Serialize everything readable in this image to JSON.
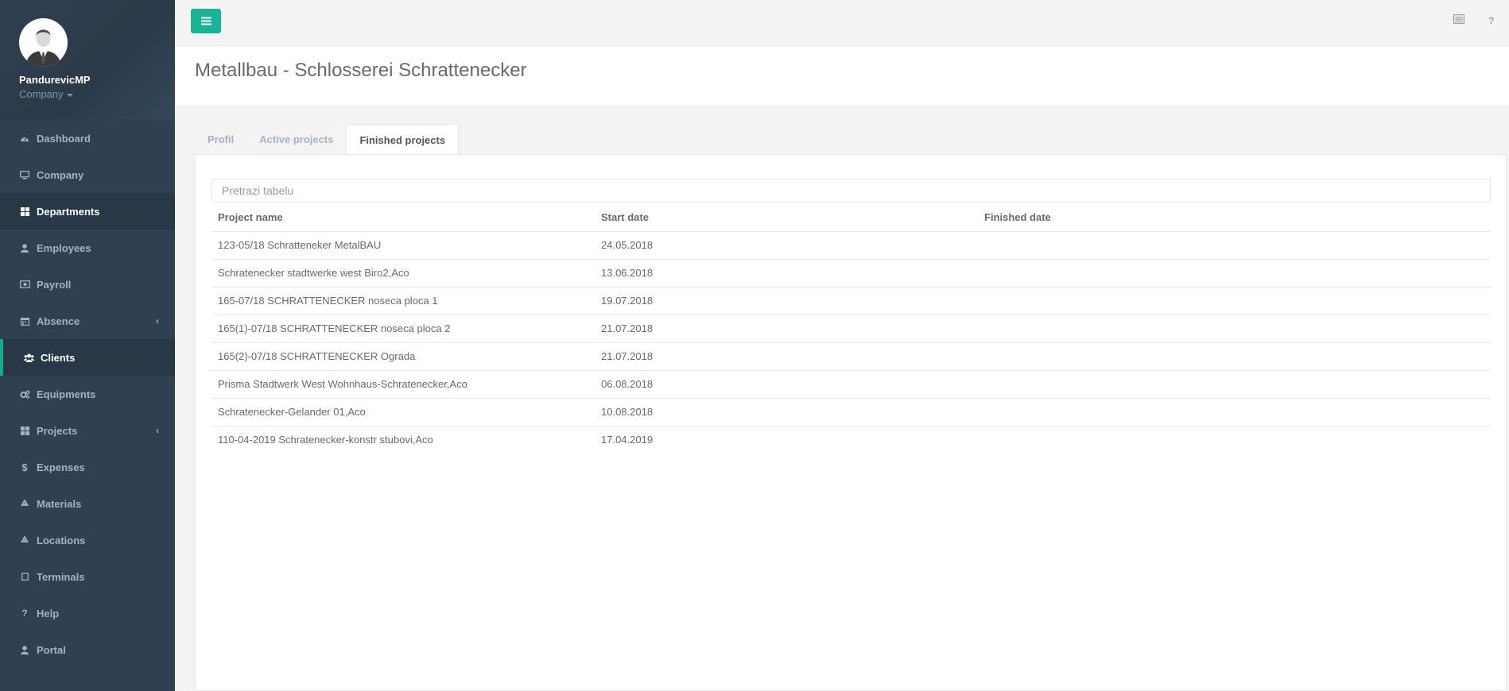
{
  "user": {
    "name": "PandurevicMP",
    "role_menu": "Company"
  },
  "sidebar": {
    "items": [
      {
        "label": "Dashboard",
        "icon": "tachometer-icon"
      },
      {
        "label": "Company",
        "icon": "desktop-icon"
      },
      {
        "label": "Departments",
        "icon": "grid-icon"
      },
      {
        "label": "Employees",
        "icon": "user-icon"
      },
      {
        "label": "Payroll",
        "icon": "money-icon"
      },
      {
        "label": "Absence",
        "icon": "calendar-icon"
      },
      {
        "label": "Clients",
        "icon": "users-icon"
      },
      {
        "label": "Equipments",
        "icon": "cogs-icon"
      },
      {
        "label": "Projects",
        "icon": "grid-icon"
      },
      {
        "label": "Expenses",
        "icon": "dollar-icon"
      },
      {
        "label": "Materials",
        "icon": "recycle-icon"
      },
      {
        "label": "Locations",
        "icon": "recycle-icon"
      },
      {
        "label": "Terminals",
        "icon": "square-icon"
      },
      {
        "label": "Help",
        "icon": "question-icon"
      },
      {
        "label": "Portal",
        "icon": "user-icon"
      }
    ]
  },
  "topbar": {
    "menu_icon": "bars-icon",
    "right_icons": [
      "list-icon",
      "question-icon"
    ],
    "accent_color": "#1ab394"
  },
  "page": {
    "title": "Metallbau - Schlosserei Schrattenecker"
  },
  "tabs": [
    {
      "label": "Profil"
    },
    {
      "label": "Active projects"
    },
    {
      "label": "Finished projects"
    }
  ],
  "search": {
    "placeholder": "Pretrazi tabelu"
  },
  "table": {
    "headers": [
      "Project name",
      "Start date",
      "Finished date"
    ],
    "rows": [
      {
        "name": "123-05/18 Schratteneker MetalBAU",
        "start": "24.05.2018",
        "finished": ""
      },
      {
        "name": "Schratenecker stadtwerke west Biro2,Aco",
        "start": "13.06.2018",
        "finished": ""
      },
      {
        "name": "165-07/18 SCHRATTENECKER noseca ploca 1",
        "start": "19.07.2018",
        "finished": ""
      },
      {
        "name": "165(1)-07/18 SCHRATTENECKER noseca ploca 2",
        "start": "21.07.2018",
        "finished": ""
      },
      {
        "name": "165(2)-07/18 SCHRATTENECKER Ograda",
        "start": "21.07.2018",
        "finished": ""
      },
      {
        "name": "Prisma Stadtwerk West Wohnhaus-Schratenecker,Aco",
        "start": "06.08.2018",
        "finished": ""
      },
      {
        "name": "Schratenecker-Gelander 01,Aco",
        "start": "10.08.2018",
        "finished": ""
      },
      {
        "name": "110-04-2019 Schratenecker-konstr stubovi,Aco",
        "start": "17.04.2019",
        "finished": ""
      }
    ]
  }
}
